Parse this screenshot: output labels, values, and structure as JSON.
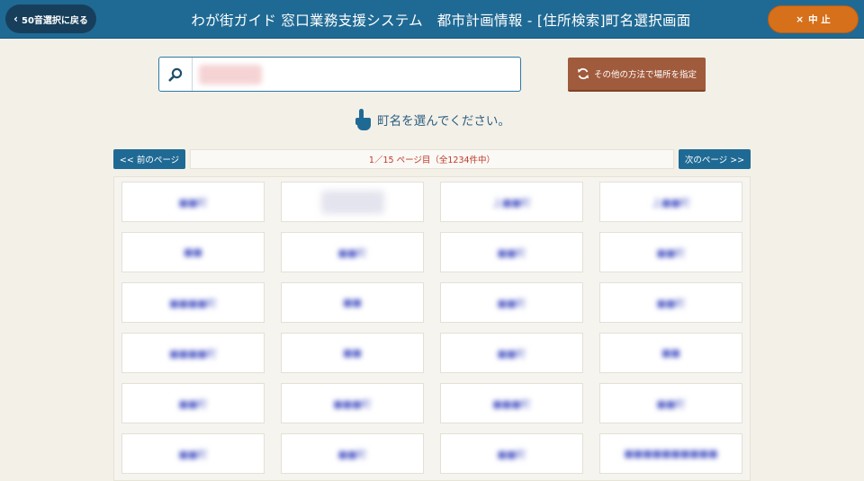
{
  "header": {
    "back_label": "50音選択に戻る",
    "title": "わが街ガイド 窓口業務支援システム　都市計画情報 - [住所検索]町名選択画面",
    "cancel_label": "中 止",
    "cancel_icon": "×",
    "back_icon": "‹"
  },
  "search": {
    "value": "",
    "placeholder": ""
  },
  "other_method": {
    "label": "その他の方法で場所を指定"
  },
  "instruction": {
    "text": "町名を選んでください。"
  },
  "pagination": {
    "prev_label": "<< 前のページ",
    "next_label": "次のページ >>",
    "info": "1／15 ページ目（全1234件中）"
  },
  "towns": [
    {
      "label": "■■町"
    },
    {
      "label": ""
    },
    {
      "label": "上■■町"
    },
    {
      "label": "上■■町"
    },
    {
      "label": "■■"
    },
    {
      "label": "■■町"
    },
    {
      "label": "■■町"
    },
    {
      "label": "■■町"
    },
    {
      "label": "■■■■町"
    },
    {
      "label": "■■"
    },
    {
      "label": "■■町"
    },
    {
      "label": "■■町"
    },
    {
      "label": "■■■■町"
    },
    {
      "label": "■■"
    },
    {
      "label": "■■町"
    },
    {
      "label": "■■"
    },
    {
      "label": "■■町"
    },
    {
      "label": "■■■町"
    },
    {
      "label": "■■■町"
    },
    {
      "label": "■■町"
    },
    {
      "label": "■■町"
    },
    {
      "label": "■■町"
    },
    {
      "label": "■■町"
    },
    {
      "label": "■■■■■■■■■■"
    }
  ],
  "colors": {
    "header": "#1f6a94",
    "cancel": "#d7701a",
    "other_method": "#a05a3c",
    "page_info_text": "#c0392b"
  }
}
